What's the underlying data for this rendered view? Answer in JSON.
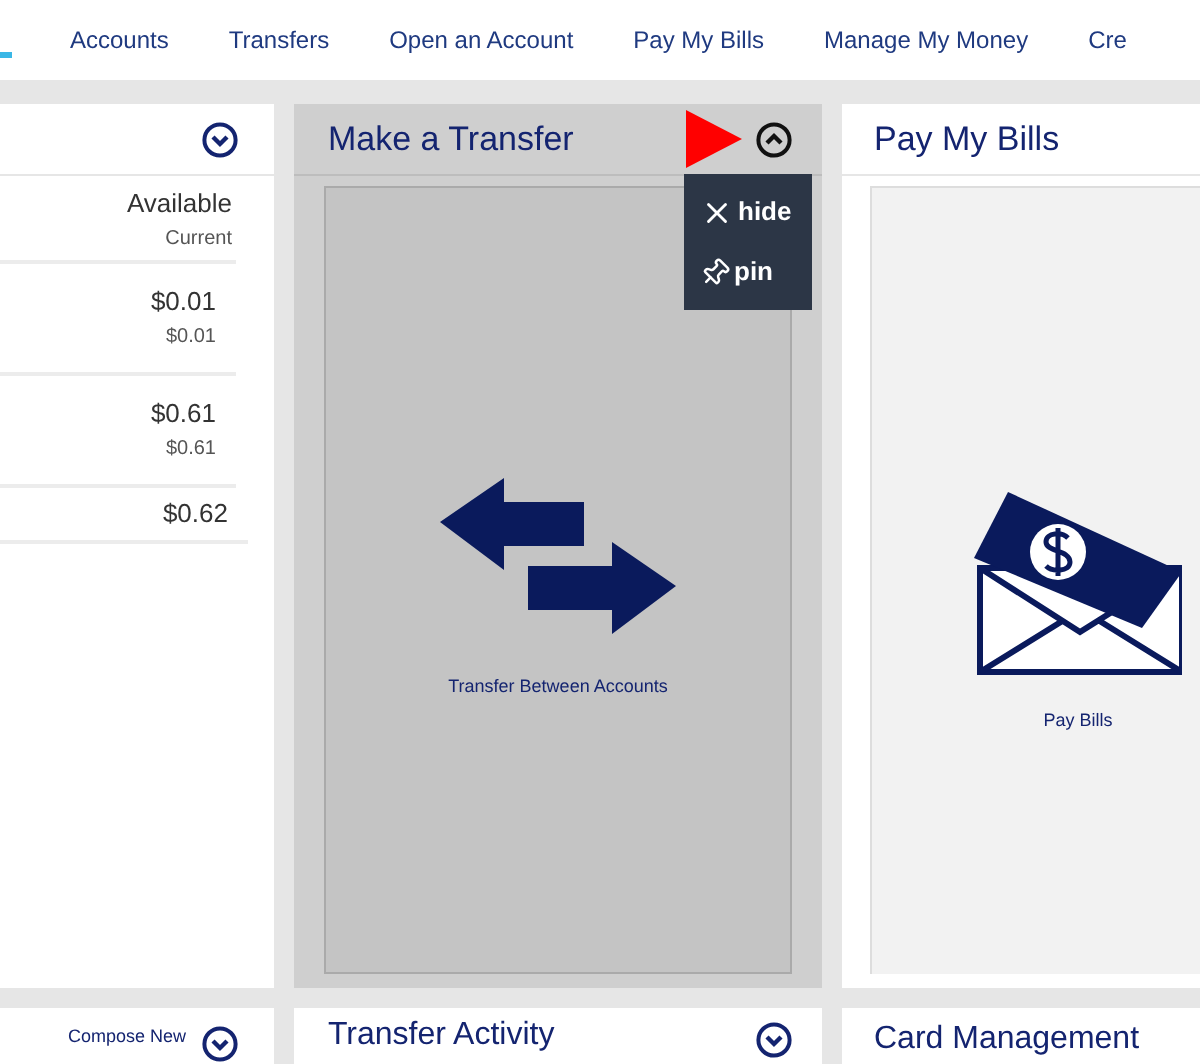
{
  "nav": {
    "items": [
      "Accounts",
      "Transfers",
      "Open an Account",
      "Pay My Bills",
      "Manage My Money",
      "Cre"
    ]
  },
  "accounts_panel": {
    "header_available": "Available",
    "header_current": "Current",
    "rows": [
      {
        "available": "$0.01",
        "current": "$0.01"
      },
      {
        "available": "$0.61",
        "current": "$0.61"
      }
    ],
    "total": "$0.62"
  },
  "transfer_panel": {
    "title": "Make a Transfer",
    "expanded": true,
    "tile_label": "Transfer Between Accounts",
    "menu": {
      "items": [
        {
          "kind": "hide",
          "label": "hide"
        },
        {
          "kind": "pin",
          "label": "pin"
        }
      ]
    }
  },
  "bills_panel": {
    "title": "Pay My Bills",
    "tile_label": "Pay Bills"
  },
  "bottom_row": {
    "compose_link": "Compose New",
    "transfer_activity_title": "Transfer Activity",
    "card_management_title": "Card Management"
  }
}
